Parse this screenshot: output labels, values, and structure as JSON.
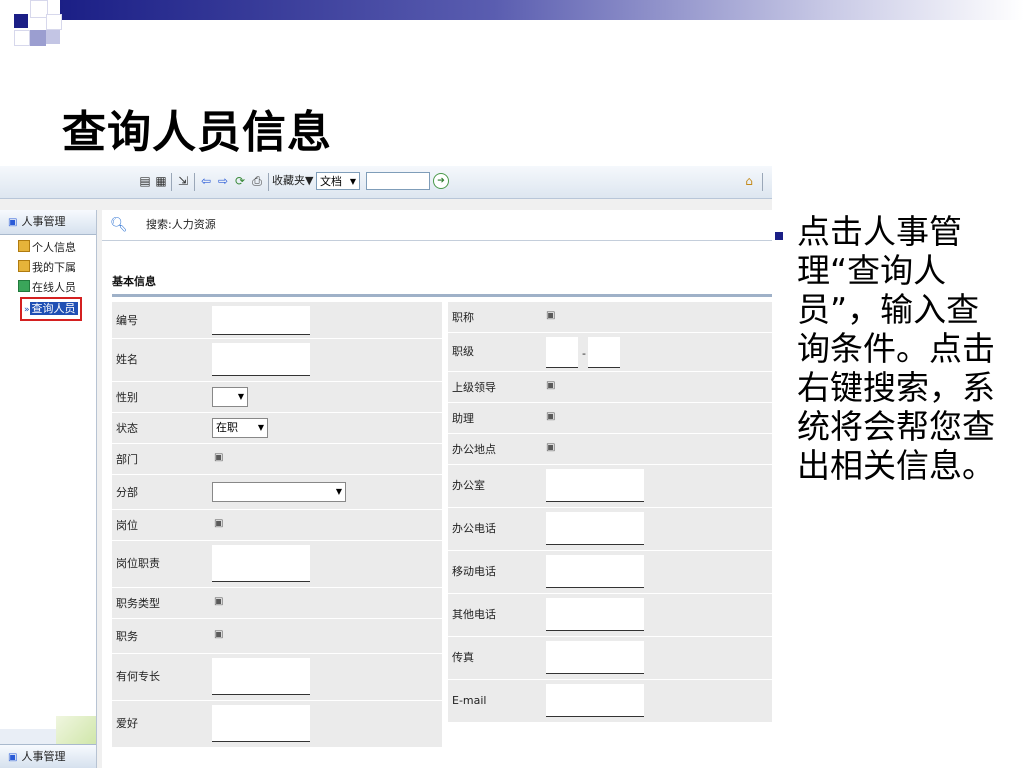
{
  "slide": {
    "title": "查询人员信息",
    "description": "点击人事管理“查询人员”，输入查询条件。点击右键搜索，系统将会帮您查出相关信息。"
  },
  "toolbar": {
    "favorites_label": "收藏夹▼",
    "doc_select_value": "文档",
    "search_placeholder": "",
    "icons": [
      "list-icon",
      "list2-icon",
      "exit-icon",
      "back-arrow-icon",
      "forward-arrow-icon",
      "refresh-icon",
      "print-icon",
      "home-icon"
    ]
  },
  "nav": {
    "header": "人事管理",
    "items": [
      {
        "label": "个人信息",
        "icon": "user-info-icon"
      },
      {
        "label": "我的下属",
        "icon": "subordinates-icon"
      },
      {
        "label": "在线人员",
        "icon": "online-icon"
      },
      {
        "label": "查询人员",
        "icon": "search-person-icon",
        "selected": true
      }
    ],
    "footer": "人事管理"
  },
  "content": {
    "breadcrumb": "搜索:人力资源",
    "section_title": "基本信息",
    "left_fields": [
      {
        "label": "编号",
        "type": "text"
      },
      {
        "label": "姓名",
        "type": "text"
      },
      {
        "label": "性别",
        "type": "select",
        "value": ""
      },
      {
        "label": "状态",
        "type": "select",
        "value": "在职"
      },
      {
        "label": "部门",
        "type": "picker"
      },
      {
        "label": "分部",
        "type": "select",
        "value": ""
      },
      {
        "label": "岗位",
        "type": "picker"
      },
      {
        "label": "岗位职责",
        "type": "text"
      },
      {
        "label": "职务类型",
        "type": "picker"
      },
      {
        "label": "职务",
        "type": "picker"
      },
      {
        "label": "有何专长",
        "type": "text"
      },
      {
        "label": "爱好",
        "type": "text"
      }
    ],
    "right_fields": [
      {
        "label": "职称",
        "type": "picker"
      },
      {
        "label": "职级",
        "type": "range",
        "separator": "-"
      },
      {
        "label": "上级领导",
        "type": "picker"
      },
      {
        "label": "助理",
        "type": "picker"
      },
      {
        "label": "办公地点",
        "type": "picker"
      },
      {
        "label": "办公室",
        "type": "text"
      },
      {
        "label": "办公电话",
        "type": "text"
      },
      {
        "label": "移动电话",
        "type": "text"
      },
      {
        "label": "其他电话",
        "type": "text"
      },
      {
        "label": "传真",
        "type": "text"
      },
      {
        "label": "E-mail",
        "type": "text"
      }
    ]
  },
  "colors": {
    "accent": "#1b1f86",
    "selected_nav_border": "#d42020",
    "selected_nav_fill": "#1f4fb4",
    "form_row_bg": "#ebebeb"
  }
}
